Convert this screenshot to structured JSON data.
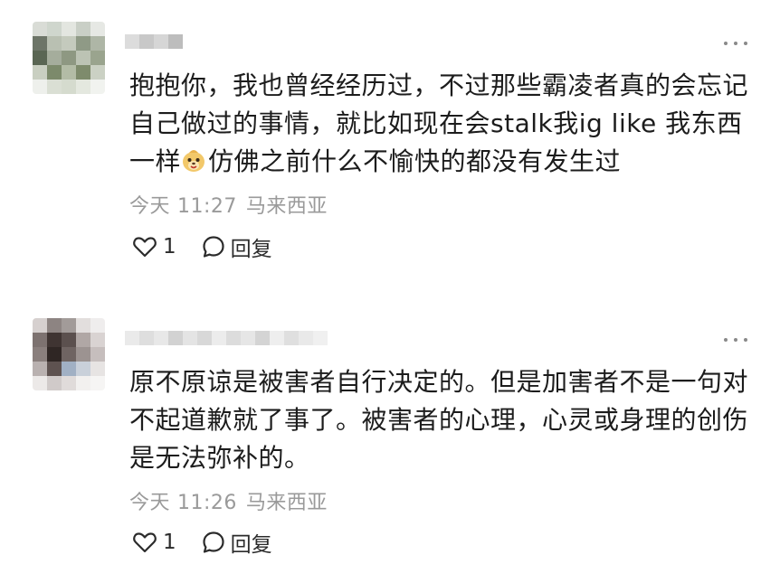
{
  "comments": [
    {
      "text_parts": [
        "抱抱你，我也曾经经历过，不过那些霸凌者真的会忘记自己做过的事情，就比如现在会stalk我ig like 我东西一样",
        "仿佛之前什么不愉快的都没有发生过"
      ],
      "emoji_icon": "smiling-meerkat-emoji-icon",
      "date": "今天",
      "time": "11:27",
      "location": "马来西亚",
      "like_count": "1",
      "reply_label": "回复"
    },
    {
      "text_parts": [
        "原不原谅是被害者自行决定的。但是加害者不是一句对不起道歉就了事了。被害者的心理，心灵或身理的创伤是无法弥补的。"
      ],
      "date": "今天",
      "time": "11:26",
      "location": "马来西亚",
      "like_count": "1",
      "reply_label": "回复"
    }
  ],
  "icons": {
    "more": "more-dots-icon",
    "like": "heart-outline-icon",
    "reply": "speech-bubble-icon"
  },
  "colors": {
    "text": "#1c1c1c",
    "meta": "#9a9a9a",
    "icon": "#2b2b2b"
  }
}
